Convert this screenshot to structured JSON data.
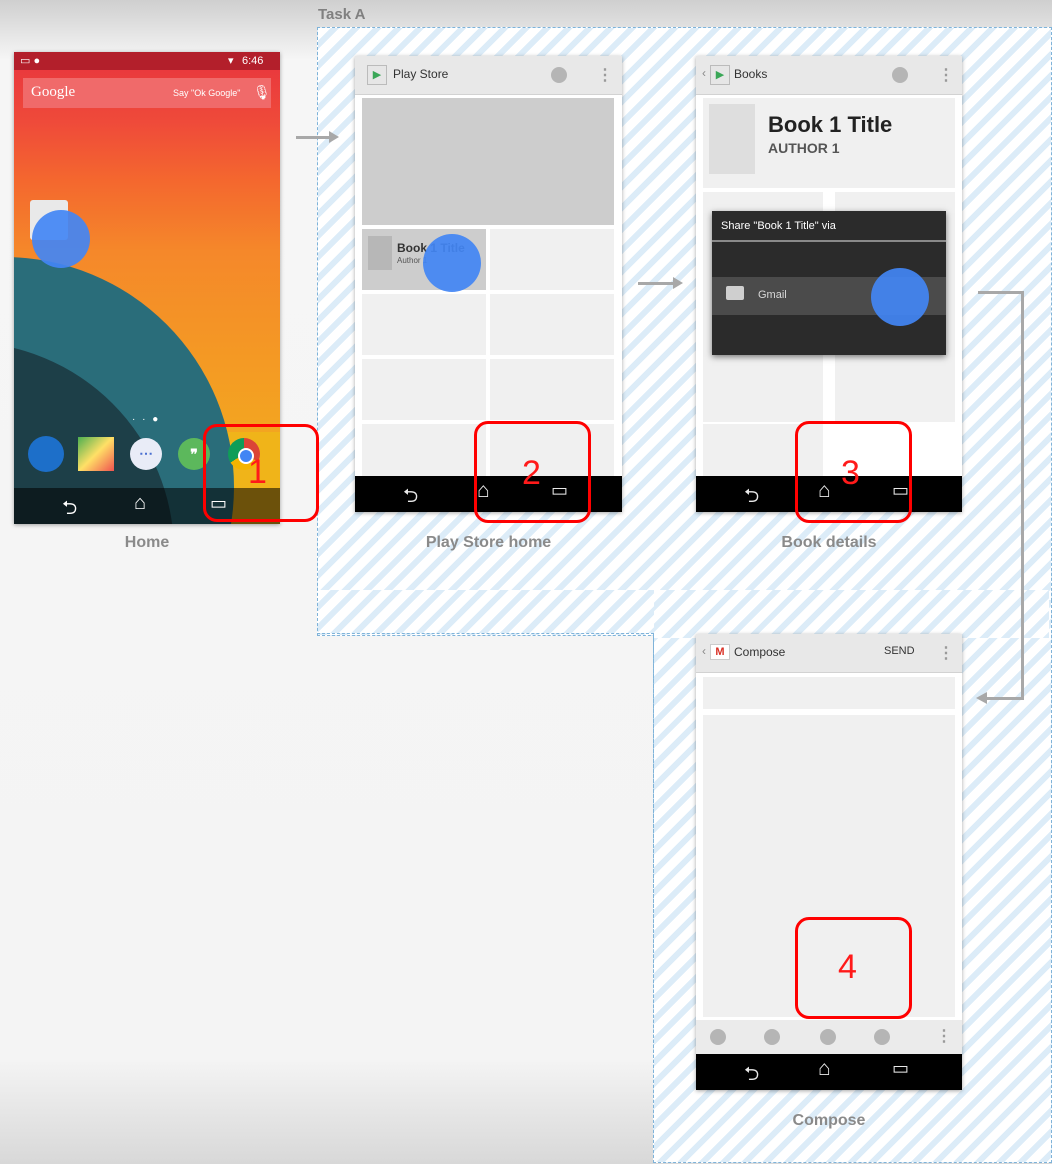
{
  "task": {
    "label": "Task A"
  },
  "screens": {
    "home": {
      "caption": "Home",
      "status_time": "6:46",
      "search_brand": "Google",
      "search_hint": "Say \"Ok Google\""
    },
    "play_store": {
      "caption": "Play Store home",
      "app_title": "Play Store",
      "book_title": "Book 1 Title",
      "book_author": "Author 1"
    },
    "book_details": {
      "caption": "Book details",
      "app_title": "Books",
      "book_title": "Book 1 Title",
      "book_author": "AUTHOR 1",
      "share_title": "Share \"Book 1 Title\" via",
      "share_option": "Gmail"
    },
    "compose": {
      "caption": "Compose",
      "app_title": "Compose",
      "send_label": "SEND"
    }
  },
  "steps": [
    "1",
    "2",
    "3",
    "4"
  ],
  "colors": {
    "touch": "#4285f4",
    "highlight": "#ff0000",
    "task_border": "#7fb3d9"
  }
}
